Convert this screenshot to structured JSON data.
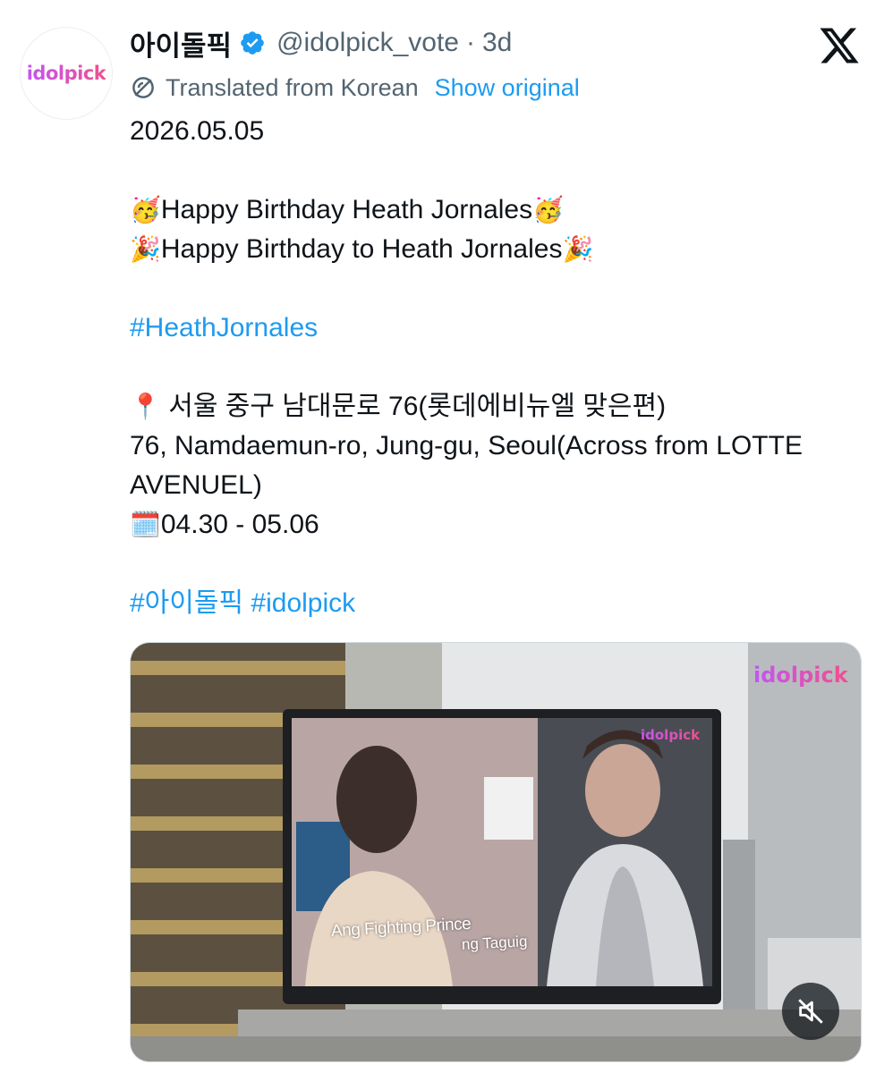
{
  "post": {
    "author": {
      "name": "아이돌픽",
      "handle": "@idolpick_vote",
      "separator": "·",
      "time": "3d",
      "avatar_text": "idolpick",
      "verified": true
    },
    "translation": {
      "label": "Translated from Korean",
      "show_original": "Show original"
    },
    "body": {
      "date": "2026.05.05",
      "birthday_line_1": "Happy Birthday Heath Jornales",
      "birthday_line_2": "Happy Birthday to Heath Jornales",
      "hashtag_primary": "#HeathJornales",
      "address_korean": "서울 중구 남대문로 76(롯데에비뉴엘 맞은편)",
      "address_english": "76, Namdaemun-ro, Jung-gu, Seoul(Across from LOTTE AVENUEL)",
      "dates": "04.30 - 05.06",
      "hashtags_footer": "#아이돌픽 #idolpick"
    },
    "emojis": {
      "party_face": "🥳",
      "party_popper": "🎉",
      "pin": "📍",
      "calendar": "🗓️"
    },
    "media": {
      "watermark_corner": "idolpick",
      "watermark_screen": "idolpick",
      "caption_main": "Ang Fighting Prince",
      "caption_sub": "ng Taguig"
    }
  },
  "icons": {
    "verified": "verified-badge-icon",
    "translate": "translate-icon",
    "logo": "x-logo-icon",
    "mute": "muted-speaker-icon"
  },
  "colors": {
    "text": "#0f1419",
    "secondary": "#536471",
    "link": "#1d9bf0",
    "verified": "#1d9bf0",
    "brand_gradient_start": "#c455f2",
    "brand_gradient_end": "#f0508f"
  }
}
